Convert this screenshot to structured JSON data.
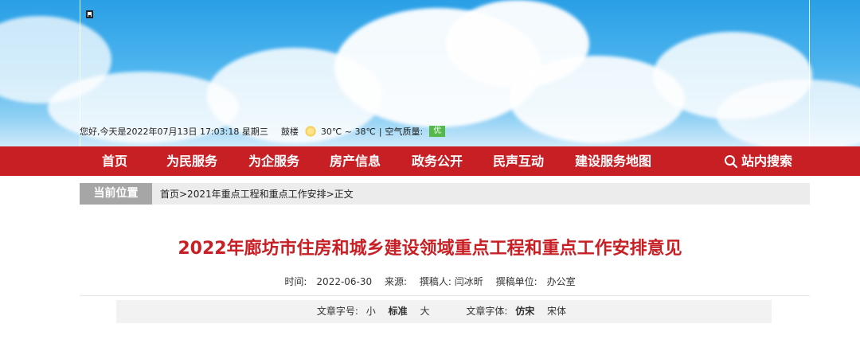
{
  "header": {
    "date_text": "您好,今天是2022年07月13日 17:03:18 星期三",
    "city": "鼓楼",
    "weather_icon": "sun-icon",
    "temperature": "30℃ ~ 38℃",
    "separator": "|",
    "air_quality_label": "空气质量:",
    "air_quality_value": "优",
    "air_quality_color": "#54b94a"
  },
  "nav": {
    "items": [
      "首页",
      "为民服务",
      "为企服务",
      "房产信息",
      "政务公开",
      "民声互动",
      "建设服务地图"
    ],
    "search_label": "站内搜索",
    "color": "#c81f25"
  },
  "breadcrumb": {
    "label": "当前位置",
    "path": "首页>2021年重点工程和重点工作安排>正文"
  },
  "article": {
    "title": "2022年廊坊市住房和城乡建设领域重点工程和重点工作安排意见",
    "title_color": "#c81f25",
    "time_label": "时间:",
    "time_value": "2022-06-30",
    "source_label": "来源:",
    "author_label": "撰稿人: 闫冰昕",
    "unit_label": "撰稿单位:",
    "unit_value": "办公室"
  },
  "toolbar": {
    "font_size_label": "文章字号:",
    "size_small": "小",
    "size_standard": "标准",
    "size_large": "大",
    "font_face_label": "文章字体:",
    "face_fangsong": "仿宋",
    "face_songti": "宋体"
  }
}
